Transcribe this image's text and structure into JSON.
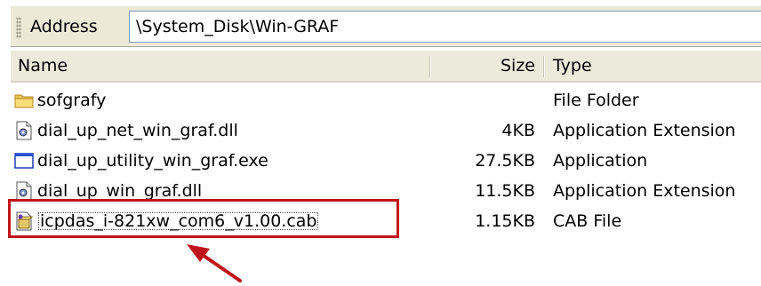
{
  "address_bar": {
    "label": "Address",
    "path": "\\System_Disk\\Win-GRAF"
  },
  "columns": {
    "name": "Name",
    "size": "Size",
    "type": "Type"
  },
  "files": [
    {
      "name": "sofgrafy",
      "size": "",
      "type": "File Folder",
      "icon": "folder-icon"
    },
    {
      "name": "dial_up_net_win_graf.dll",
      "size": "4KB",
      "type": "Application Extension",
      "icon": "dll-file-icon"
    },
    {
      "name": "dial_up_utility_win_graf.exe",
      "size": "27.5KB",
      "type": "Application",
      "icon": "application-icon"
    },
    {
      "name": "dial_up_win_graf.dll",
      "size": "11.5KB",
      "type": "Application Extension",
      "icon": "dll-file-icon"
    },
    {
      "name": "icpdas_i-821xw_com6_v1.00.cab",
      "size": "1.15KB",
      "type": "CAB File",
      "icon": "cab-file-icon"
    }
  ],
  "annotation": {
    "highlight_color": "#c0141c",
    "highlighted_file": "icpdas_i-821xw_com6_v1.00.cab"
  }
}
